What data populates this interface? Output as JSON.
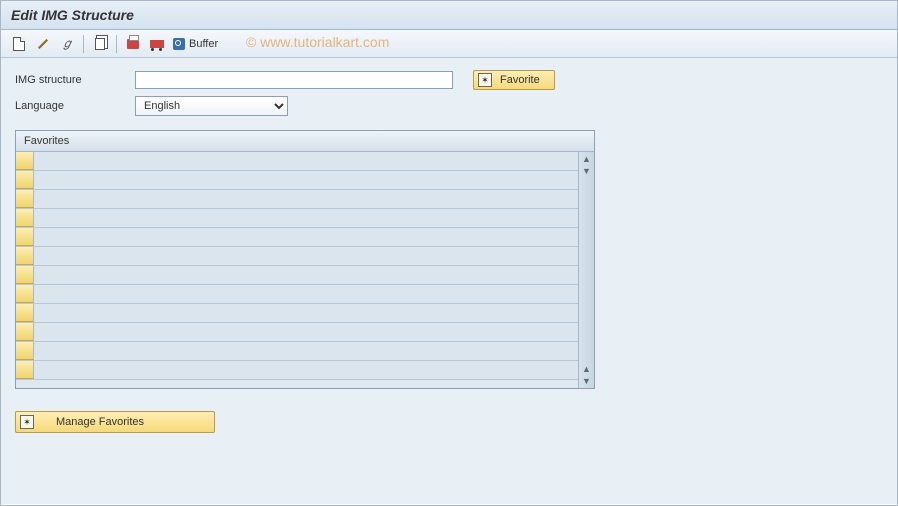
{
  "title": "Edit IMG Structure",
  "toolbar": {
    "buffer_label": "Buffer"
  },
  "watermark": "© www.tutorialkart.com",
  "form": {
    "img_structure_label": "IMG structure",
    "img_structure_value": "",
    "language_label": "Language",
    "language_value": "English"
  },
  "buttons": {
    "favorite": "Favorite",
    "manage_favorites": "Manage Favorites"
  },
  "grid": {
    "header": "Favorites",
    "rows": [
      "",
      "",
      "",
      "",
      "",
      "",
      "",
      "",
      "",
      "",
      "",
      ""
    ]
  }
}
